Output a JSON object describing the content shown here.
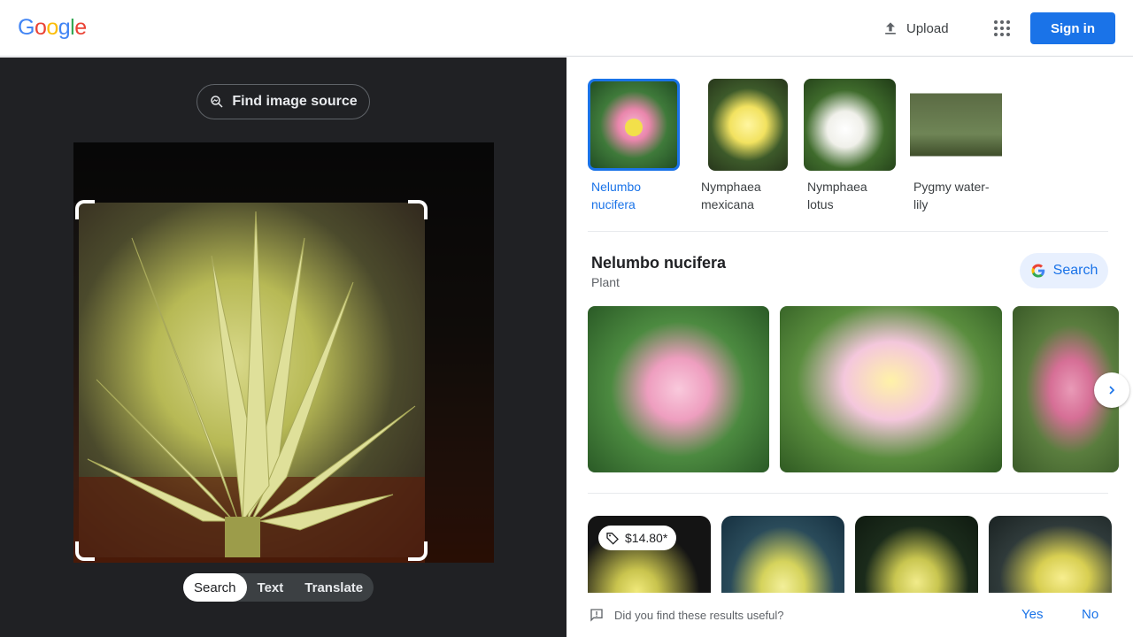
{
  "header": {
    "logo": "Google",
    "upload_label": "Upload",
    "signin_label": "Sign in"
  },
  "left_panel": {
    "find_source_label": "Find image source",
    "modes": [
      {
        "label": "Search"
      },
      {
        "label": "Text"
      },
      {
        "label": "Translate"
      }
    ]
  },
  "chips": [
    {
      "line1": "Nelumbo",
      "line2": "nucifera"
    },
    {
      "line1": "Nymphaea",
      "line2": "mexicana"
    },
    {
      "line1": "Nymphaea",
      "line2": "lotus"
    },
    {
      "line1": "Pygmy water-",
      "line2": "lily"
    }
  ],
  "knowledge": {
    "title": "Nelumbo nucifera",
    "subtitle": "Plant",
    "search_label": "Search"
  },
  "results": {
    "price": "$14.80*"
  },
  "feedback": {
    "question": "Did you find these results useful?",
    "yes": "Yes",
    "no": "No"
  },
  "colors": {
    "accent": "#1a73e8",
    "dark_panel": "#202124"
  }
}
